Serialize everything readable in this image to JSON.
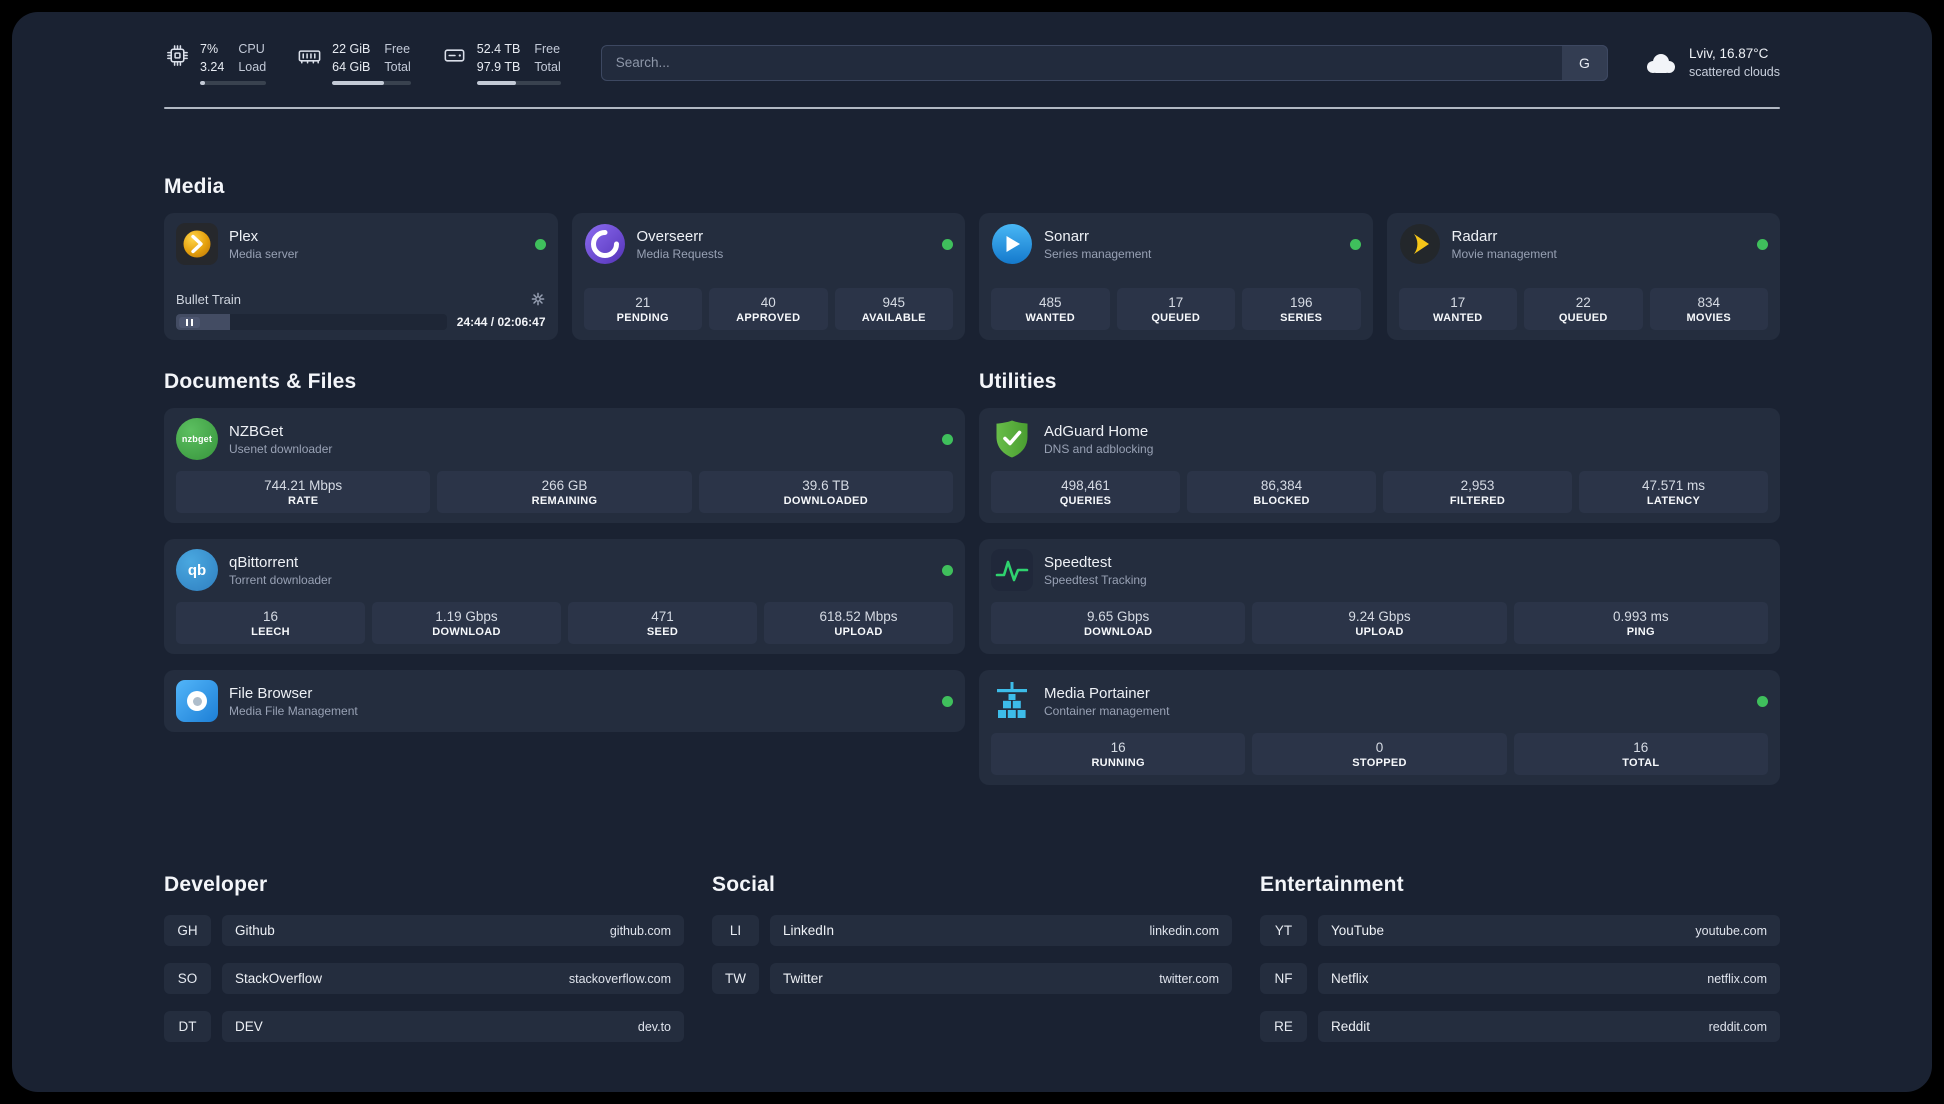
{
  "colors": {
    "app_bg": "#1a2232",
    "card_bg": "#242d3e",
    "stat_bg": "#2b3448",
    "status_green": "#3fbf5c",
    "plex_amber": "#e5a00d",
    "overseerr_purple": "#6741d9",
    "sonarr_blue": "#2196f3",
    "radarr_amber": "#f5c518",
    "adguard_green": "#68bd49",
    "portainer_blue": "#3dbce9"
  },
  "icons": {
    "cpu": "cpu-chip",
    "ram": "memory-module",
    "disk": "hard-drive",
    "weather": "cloud",
    "settings": "gear",
    "playback": "pause-bars",
    "status": "green-dot"
  },
  "topbar": {
    "cpu": {
      "percent": "7%",
      "load": "3.24",
      "label_top": "CPU",
      "label_bottom": "Load"
    },
    "ram": {
      "free": "22 GiB",
      "total": "64 GiB",
      "label_top": "Free",
      "label_bottom": "Total"
    },
    "disk": {
      "free": "52.4 TB",
      "total": "97.9 TB",
      "label_top": "Free",
      "label_bottom": "Total"
    },
    "search": {
      "placeholder": "Search...",
      "engine": "G"
    },
    "weather": {
      "location": "Lviv, 16.87°C",
      "condition": "scattered clouds"
    }
  },
  "sections": {
    "media": "Media",
    "documents": "Documents & Files",
    "utilities": "Utilities",
    "developer": "Developer",
    "social": "Social",
    "entertainment": "Entertainment"
  },
  "apps": {
    "plex": {
      "name": "Plex",
      "subtitle": "Media server",
      "now_playing": "Bullet Train",
      "time": "24:44 / 02:06:47"
    },
    "overseerr": {
      "name": "Overseerr",
      "subtitle": "Media Requests",
      "stats": [
        {
          "value": "21",
          "label": "PENDING"
        },
        {
          "value": "40",
          "label": "APPROVED"
        },
        {
          "value": "945",
          "label": "AVAILABLE"
        }
      ]
    },
    "sonarr": {
      "name": "Sonarr",
      "subtitle": "Series management",
      "stats": [
        {
          "value": "485",
          "label": "WANTED"
        },
        {
          "value": "17",
          "label": "QUEUED"
        },
        {
          "value": "196",
          "label": "SERIES"
        }
      ]
    },
    "radarr": {
      "name": "Radarr",
      "subtitle": "Movie management",
      "stats": [
        {
          "value": "17",
          "label": "WANTED"
        },
        {
          "value": "22",
          "label": "QUEUED"
        },
        {
          "value": "834",
          "label": "MOVIES"
        }
      ]
    },
    "nzbget": {
      "name": "NZBGet",
      "subtitle": "Usenet downloader",
      "icon_text": "nzbget",
      "stats": [
        {
          "value": "744.21 Mbps",
          "label": "RATE"
        },
        {
          "value": "266 GB",
          "label": "REMAINING"
        },
        {
          "value": "39.6 TB",
          "label": "DOWNLOADED"
        }
      ]
    },
    "qbittorrent": {
      "name": "qBittorrent",
      "subtitle": "Torrent downloader",
      "icon_text": "qb",
      "stats": [
        {
          "value": "16",
          "label": "LEECH"
        },
        {
          "value": "1.19 Gbps",
          "label": "DOWNLOAD"
        },
        {
          "value": "471",
          "label": "SEED"
        },
        {
          "value": "618.52 Mbps",
          "label": "UPLOAD"
        }
      ]
    },
    "filebrowser": {
      "name": "File Browser",
      "subtitle": "Media File Management"
    },
    "adguard": {
      "name": "AdGuard Home",
      "subtitle": "DNS and adblocking",
      "stats": [
        {
          "value": "498,461",
          "label": "QUERIES"
        },
        {
          "value": "86,384",
          "label": "BLOCKED"
        },
        {
          "value": "2,953",
          "label": "FILTERED"
        },
        {
          "value": "47.571 ms",
          "label": "LATENCY"
        }
      ]
    },
    "speedtest": {
      "name": "Speedtest",
      "subtitle": "Speedtest Tracking",
      "stats": [
        {
          "value": "9.65 Gbps",
          "label": "DOWNLOAD"
        },
        {
          "value": "9.24 Gbps",
          "label": "UPLOAD"
        },
        {
          "value": "0.993 ms",
          "label": "PING"
        }
      ]
    },
    "portainer": {
      "name": "Media Portainer",
      "subtitle": "Container management",
      "stats": [
        {
          "value": "16",
          "label": "RUNNING"
        },
        {
          "value": "0",
          "label": "STOPPED"
        },
        {
          "value": "16",
          "label": "TOTAL"
        }
      ]
    }
  },
  "links": {
    "developer": [
      {
        "abbr": "GH",
        "name": "Github",
        "url": "github.com"
      },
      {
        "abbr": "SO",
        "name": "StackOverflow",
        "url": "stackoverflow.com"
      },
      {
        "abbr": "DT",
        "name": "DEV",
        "url": "dev.to"
      }
    ],
    "social": [
      {
        "abbr": "LI",
        "name": "LinkedIn",
        "url": "linkedin.com"
      },
      {
        "abbr": "TW",
        "name": "Twitter",
        "url": "twitter.com"
      }
    ],
    "entertainment": [
      {
        "abbr": "YT",
        "name": "YouTube",
        "url": "youtube.com"
      },
      {
        "abbr": "NF",
        "name": "Netflix",
        "url": "netflix.com"
      },
      {
        "abbr": "RE",
        "name": "Reddit",
        "url": "reddit.com"
      }
    ]
  }
}
